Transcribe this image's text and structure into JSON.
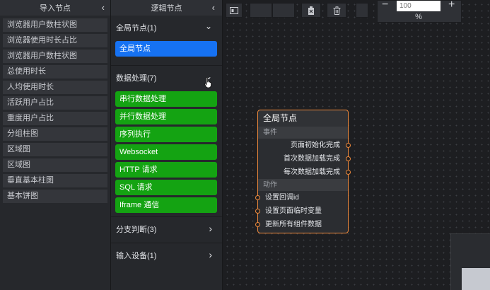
{
  "left_panel": {
    "title": "导入节点",
    "collapse_icon": "‹",
    "items": [
      {
        "label": "浏览器用户数柱状图"
      },
      {
        "label": "浏览器使用时长占比"
      },
      {
        "label": "浏览器用户数柱状图"
      },
      {
        "label": "总使用时长"
      },
      {
        "label": "人均使用时长"
      },
      {
        "label": "活跃用户占比"
      },
      {
        "label": "重度用户占比"
      },
      {
        "label": "分组柱图"
      },
      {
        "label": "区域图"
      },
      {
        "label": "区域图"
      },
      {
        "label": "垂直基本柱图"
      },
      {
        "label": "基本饼图"
      }
    ]
  },
  "mid_panel": {
    "title": "逻辑节点",
    "collapse_icon": "‹",
    "sections": {
      "global": {
        "label": "全局节点(1)",
        "chevron": "⌄",
        "items": [
          {
            "label": "全局节点"
          }
        ]
      },
      "data": {
        "label": "数据处理(7)",
        "chevron": "⌄",
        "items": [
          {
            "label": "串行数据处理"
          },
          {
            "label": "并行数据处理"
          },
          {
            "label": "序列执行"
          },
          {
            "label": "Websocket"
          },
          {
            "label": "HTTP 请求"
          },
          {
            "label": "SQL 请求"
          },
          {
            "label": "Iframe 通信"
          }
        ]
      },
      "branch": {
        "label": "分支判断(3)",
        "chevron": "›"
      },
      "input": {
        "label": "输入设备(1)",
        "chevron": "›"
      }
    }
  },
  "toolbar": {
    "zoom_minus": "−",
    "zoom_plus": "+",
    "zoom_placeholder": "100",
    "zoom_percent": "%"
  },
  "node": {
    "title": "全局节点",
    "events_label": "事件",
    "events": [
      {
        "label": "页面初始化完成"
      },
      {
        "label": "首次数据加载完成"
      },
      {
        "label": "每次数据加载完成"
      }
    ],
    "actions_label": "动作",
    "actions": [
      {
        "label": "设置回调id"
      },
      {
        "label": "设置页面临时变量"
      },
      {
        "label": "更新所有组件数据"
      }
    ]
  },
  "colors": {
    "accent_blue": "#1672f3",
    "accent_green": "#14a312",
    "node_border": "#f08a3c"
  },
  "icons": [
    "collapse-left-icon",
    "chevron-down-icon",
    "chevron-right-icon",
    "layout-icon",
    "clear-icon",
    "delete-icon",
    "pointer-cursor-icon"
  ]
}
